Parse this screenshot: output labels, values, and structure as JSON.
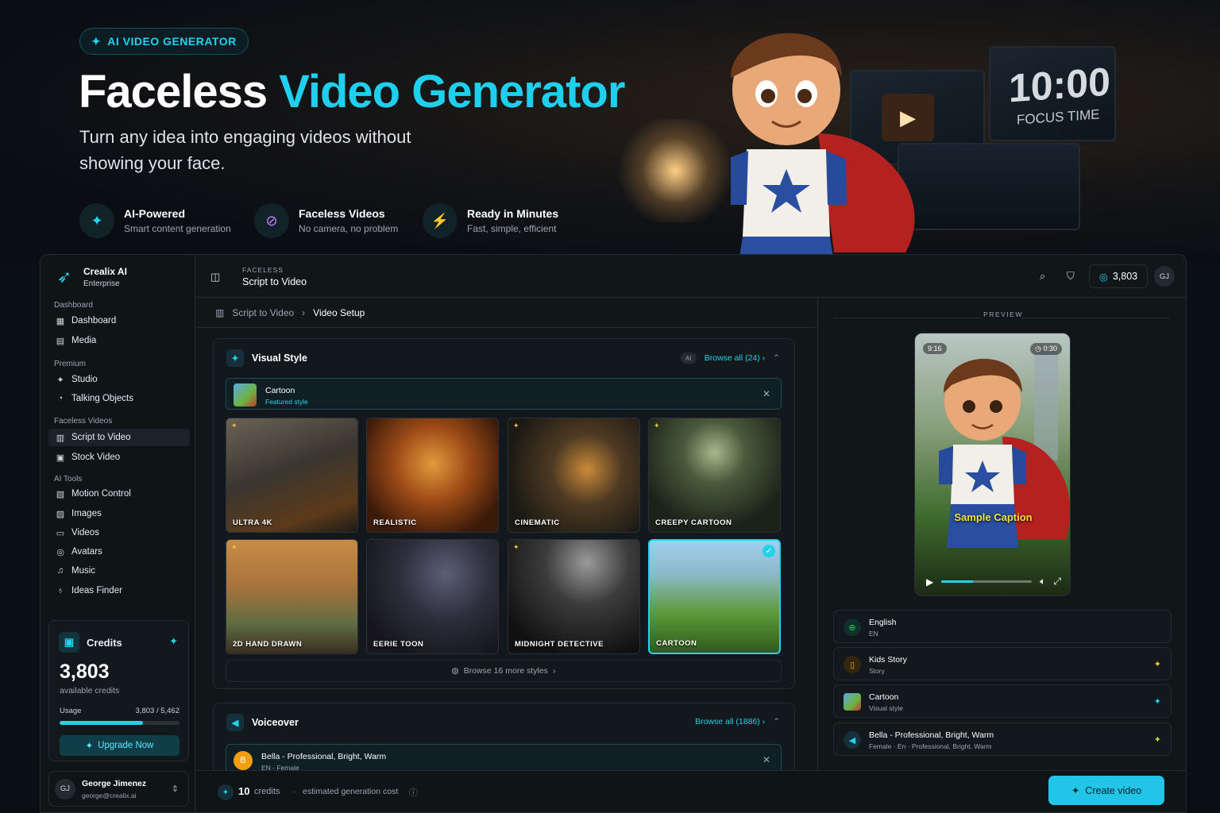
{
  "hero": {
    "badge": "AI VIDEO GENERATOR",
    "title_main": "Faceless",
    "title_accent": "Video Generator",
    "subtitle": "Turn any idea into engaging videos without showing your face.",
    "features": [
      {
        "title": "AI-Powered",
        "desc": "Smart content generation",
        "icon": "sparkles-icon"
      },
      {
        "title": "Faceless Videos",
        "desc": "No camera, no problem",
        "icon": "no-camera-icon"
      },
      {
        "title": "Ready in Minutes",
        "desc": "Fast, simple, efficient",
        "icon": "fast-icon"
      }
    ],
    "clock_text": "10:00",
    "clock_label": "FOCUS TIME"
  },
  "sidebar": {
    "brand_name": "Crealix AI",
    "brand_plan": "Enterprise",
    "sections": [
      {
        "label": "Dashboard",
        "items": [
          {
            "label": "Dashboard",
            "icon": "grid-icon"
          },
          {
            "label": "Media",
            "icon": "film-icon"
          }
        ]
      },
      {
        "label": "Premium",
        "items": [
          {
            "label": "Studio",
            "icon": "sparkles-icon"
          },
          {
            "label": "Talking Objects",
            "icon": "objects-icon"
          }
        ]
      },
      {
        "label": "Faceless Videos",
        "items": [
          {
            "label": "Script to Video",
            "icon": "script-icon",
            "active": true
          },
          {
            "label": "Stock Video",
            "icon": "clapper-icon"
          }
        ]
      },
      {
        "label": "AI Tools",
        "items": [
          {
            "label": "Motion Control",
            "icon": "motion-icon"
          },
          {
            "label": "Images",
            "icon": "image-icon"
          },
          {
            "label": "Videos",
            "icon": "video-icon"
          },
          {
            "label": "Avatars",
            "icon": "avatar-icon"
          },
          {
            "label": "Music",
            "icon": "music-icon"
          },
          {
            "label": "Ideas Finder",
            "icon": "bulb-icon"
          }
        ]
      }
    ],
    "credits": {
      "title": "Credits",
      "amount": "3,803",
      "sub": "available credits",
      "usage_label": "Usage",
      "usage_value": "3,803 / 5,462",
      "usage_fraction": 0.696,
      "upgrade": "Upgrade Now"
    },
    "user": {
      "initials": "GJ",
      "name": "George Jimenez",
      "email": "george@crealix.ai"
    }
  },
  "topbar": {
    "section": "FACELESS",
    "title": "Script to Video",
    "credits": "3,803",
    "avatar": "GJ"
  },
  "breadcrumb": {
    "root": "Script to Video",
    "current": "Video Setup"
  },
  "visual_style": {
    "title": "Visual Style",
    "ai_tag": "AI",
    "browse": "Browse all (24) ›",
    "selected": {
      "name": "Cartoon",
      "sub": "Featured style"
    },
    "tiles": [
      {
        "label": "ULTRA 4K"
      },
      {
        "label": "REALISTIC"
      },
      {
        "label": "CINEMATIC"
      },
      {
        "label": "CREEPY CARTOON"
      },
      {
        "label": "2D HAND DRAWN"
      },
      {
        "label": "EERIE TOON"
      },
      {
        "label": "MIDNIGHT DETECTIVE"
      },
      {
        "label": "CARTOON",
        "selected": true
      }
    ],
    "more": "Browse 16 more styles"
  },
  "voiceover": {
    "title": "Voiceover",
    "browse": "Browse all (1886) ›",
    "selected": {
      "initial": "B",
      "name": "Bella - Professional, Bright, Warm",
      "sub": "EN - Female"
    }
  },
  "footer": {
    "credits": "10",
    "unit": "credits",
    "dot": "·",
    "desc": "estimated generation cost",
    "create": "Create video"
  },
  "preview": {
    "label": "PREVIEW",
    "ratio": "9:16",
    "duration": "0:30",
    "caption": "Sample Caption",
    "progress_fraction": 0.35,
    "options": [
      {
        "title": "English",
        "sub": "EN",
        "icon": "globe-icon",
        "color": "#22c55e"
      },
      {
        "title": "Kids Story",
        "sub": "Story",
        "icon": "book-icon",
        "color": "#f59e0b"
      },
      {
        "title": "Cartoon",
        "sub": "Visual style",
        "icon": "thumb-icon",
        "color": "#22d3ee"
      },
      {
        "title": "Bella - Professional, Bright, Warm",
        "sub": "Female · En · Professional, Bright, Warm",
        "icon": "speaker-icon",
        "color": "#a3e635"
      }
    ]
  }
}
